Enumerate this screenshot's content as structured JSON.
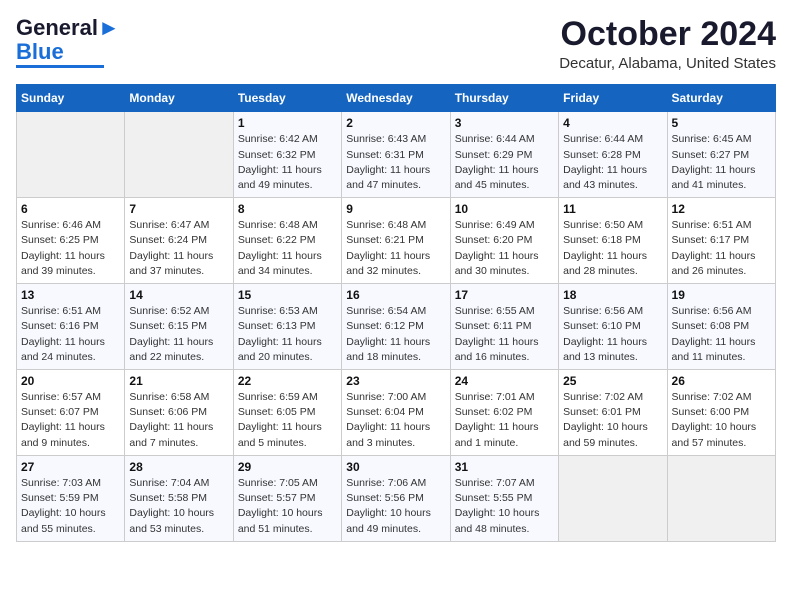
{
  "header": {
    "logo_line1": "General",
    "logo_line2": "Blue",
    "title": "October 2024",
    "subtitle": "Decatur, Alabama, United States"
  },
  "calendar": {
    "days_of_week": [
      "Sunday",
      "Monday",
      "Tuesday",
      "Wednesday",
      "Thursday",
      "Friday",
      "Saturday"
    ],
    "weeks": [
      [
        {
          "day": "",
          "detail": ""
        },
        {
          "day": "",
          "detail": ""
        },
        {
          "day": "1",
          "detail": "Sunrise: 6:42 AM\nSunset: 6:32 PM\nDaylight: 11 hours and 49 minutes."
        },
        {
          "day": "2",
          "detail": "Sunrise: 6:43 AM\nSunset: 6:31 PM\nDaylight: 11 hours and 47 minutes."
        },
        {
          "day": "3",
          "detail": "Sunrise: 6:44 AM\nSunset: 6:29 PM\nDaylight: 11 hours and 45 minutes."
        },
        {
          "day": "4",
          "detail": "Sunrise: 6:44 AM\nSunset: 6:28 PM\nDaylight: 11 hours and 43 minutes."
        },
        {
          "day": "5",
          "detail": "Sunrise: 6:45 AM\nSunset: 6:27 PM\nDaylight: 11 hours and 41 minutes."
        }
      ],
      [
        {
          "day": "6",
          "detail": "Sunrise: 6:46 AM\nSunset: 6:25 PM\nDaylight: 11 hours and 39 minutes."
        },
        {
          "day": "7",
          "detail": "Sunrise: 6:47 AM\nSunset: 6:24 PM\nDaylight: 11 hours and 37 minutes."
        },
        {
          "day": "8",
          "detail": "Sunrise: 6:48 AM\nSunset: 6:22 PM\nDaylight: 11 hours and 34 minutes."
        },
        {
          "day": "9",
          "detail": "Sunrise: 6:48 AM\nSunset: 6:21 PM\nDaylight: 11 hours and 32 minutes."
        },
        {
          "day": "10",
          "detail": "Sunrise: 6:49 AM\nSunset: 6:20 PM\nDaylight: 11 hours and 30 minutes."
        },
        {
          "day": "11",
          "detail": "Sunrise: 6:50 AM\nSunset: 6:18 PM\nDaylight: 11 hours and 28 minutes."
        },
        {
          "day": "12",
          "detail": "Sunrise: 6:51 AM\nSunset: 6:17 PM\nDaylight: 11 hours and 26 minutes."
        }
      ],
      [
        {
          "day": "13",
          "detail": "Sunrise: 6:51 AM\nSunset: 6:16 PM\nDaylight: 11 hours and 24 minutes."
        },
        {
          "day": "14",
          "detail": "Sunrise: 6:52 AM\nSunset: 6:15 PM\nDaylight: 11 hours and 22 minutes."
        },
        {
          "day": "15",
          "detail": "Sunrise: 6:53 AM\nSunset: 6:13 PM\nDaylight: 11 hours and 20 minutes."
        },
        {
          "day": "16",
          "detail": "Sunrise: 6:54 AM\nSunset: 6:12 PM\nDaylight: 11 hours and 18 minutes."
        },
        {
          "day": "17",
          "detail": "Sunrise: 6:55 AM\nSunset: 6:11 PM\nDaylight: 11 hours and 16 minutes."
        },
        {
          "day": "18",
          "detail": "Sunrise: 6:56 AM\nSunset: 6:10 PM\nDaylight: 11 hours and 13 minutes."
        },
        {
          "day": "19",
          "detail": "Sunrise: 6:56 AM\nSunset: 6:08 PM\nDaylight: 11 hours and 11 minutes."
        }
      ],
      [
        {
          "day": "20",
          "detail": "Sunrise: 6:57 AM\nSunset: 6:07 PM\nDaylight: 11 hours and 9 minutes."
        },
        {
          "day": "21",
          "detail": "Sunrise: 6:58 AM\nSunset: 6:06 PM\nDaylight: 11 hours and 7 minutes."
        },
        {
          "day": "22",
          "detail": "Sunrise: 6:59 AM\nSunset: 6:05 PM\nDaylight: 11 hours and 5 minutes."
        },
        {
          "day": "23",
          "detail": "Sunrise: 7:00 AM\nSunset: 6:04 PM\nDaylight: 11 hours and 3 minutes."
        },
        {
          "day": "24",
          "detail": "Sunrise: 7:01 AM\nSunset: 6:02 PM\nDaylight: 11 hours and 1 minute."
        },
        {
          "day": "25",
          "detail": "Sunrise: 7:02 AM\nSunset: 6:01 PM\nDaylight: 10 hours and 59 minutes."
        },
        {
          "day": "26",
          "detail": "Sunrise: 7:02 AM\nSunset: 6:00 PM\nDaylight: 10 hours and 57 minutes."
        }
      ],
      [
        {
          "day": "27",
          "detail": "Sunrise: 7:03 AM\nSunset: 5:59 PM\nDaylight: 10 hours and 55 minutes."
        },
        {
          "day": "28",
          "detail": "Sunrise: 7:04 AM\nSunset: 5:58 PM\nDaylight: 10 hours and 53 minutes."
        },
        {
          "day": "29",
          "detail": "Sunrise: 7:05 AM\nSunset: 5:57 PM\nDaylight: 10 hours and 51 minutes."
        },
        {
          "day": "30",
          "detail": "Sunrise: 7:06 AM\nSunset: 5:56 PM\nDaylight: 10 hours and 49 minutes."
        },
        {
          "day": "31",
          "detail": "Sunrise: 7:07 AM\nSunset: 5:55 PM\nDaylight: 10 hours and 48 minutes."
        },
        {
          "day": "",
          "detail": ""
        },
        {
          "day": "",
          "detail": ""
        }
      ]
    ]
  }
}
